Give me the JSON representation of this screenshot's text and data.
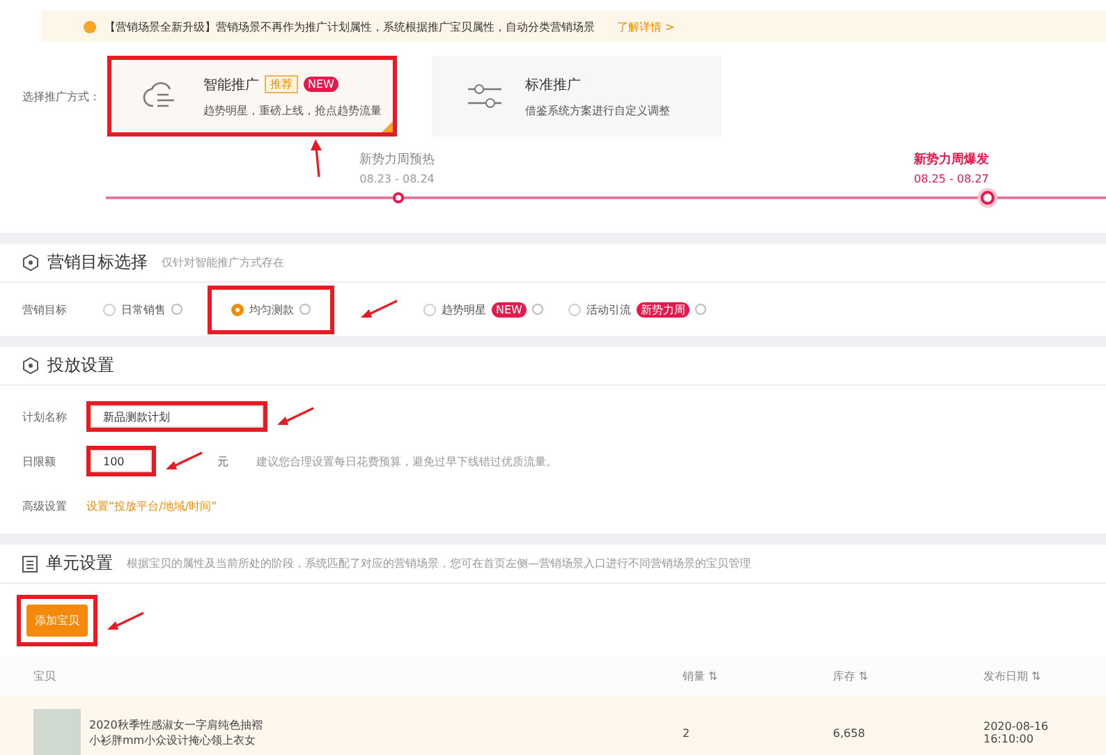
{
  "notice": {
    "text": "【营销场景全新升级】营销场景不再作为推广计划属性，系统根据推广宝贝属性，自动分类营销场景",
    "link": "了解详情 >"
  },
  "promotion": {
    "label": "选择推广方式：",
    "modes": [
      {
        "kind": "smart",
        "title": "智能推广",
        "tags": [
          {
            "text": "推荐",
            "kind": "outline"
          },
          {
            "text": "NEW",
            "kind": "solid"
          }
        ],
        "desc": "趋势明星，重磅上线，抢点趋势流量",
        "selected": true,
        "highlighted": true
      },
      {
        "kind": "standard",
        "title": "标准推广",
        "desc": "借鉴系统方案进行自定义调整",
        "selected": false,
        "highlighted": false
      }
    ]
  },
  "timeline": [
    {
      "title": "新势力周预热",
      "dates": "08.23 - 08.24",
      "selected": false
    },
    {
      "title": "新势力周爆发",
      "dates": "08.25 - 08.27",
      "selected": true
    }
  ],
  "goal_section": {
    "title": "营销目标选择",
    "hint": "仅针对智能推广方式存在",
    "label": "营销目标",
    "options": [
      {
        "label": "日常销售",
        "selected": false,
        "highlighted": false
      },
      {
        "label": "均匀测款",
        "selected": true,
        "highlighted": true
      },
      {
        "label": "趋势明星",
        "badge": "NEW",
        "selected": false,
        "highlighted": false
      },
      {
        "label": "活动引流",
        "badge": "新势力周",
        "selected": false,
        "highlighted": false
      }
    ]
  },
  "delivery_section": {
    "title": "投放设置",
    "fields": [
      {
        "kind": "text",
        "label": "计划名称",
        "value": "新品测款计划",
        "highlighted": true
      },
      {
        "kind": "money",
        "label": "日限额",
        "value": "100",
        "unit": "元",
        "hint": "建议您合理设置每日花费预算，避免过早下线错过优质流量。",
        "highlighted": true
      },
      {
        "kind": "link",
        "label": "高级设置",
        "value": "设置“投放平台/地域/时间”",
        "highlighted": false
      }
    ]
  },
  "unit_section": {
    "title": "单元设置",
    "hint": "根据宝贝的属性及当前所处的阶段，系统匹配了对应的营销场景，您可在首页左侧—营销场景入口进行不同营销场景的宝贝管理",
    "button": {
      "label": "添加宝贝",
      "highlighted": true
    },
    "table": {
      "columns": [
        "宝贝",
        "销量 ⇅",
        "库存 ⇅",
        "发布日期 ⇅"
      ],
      "rows": [
        {
          "title": "2020秋季性感淑女一字肩纯色抽褶小衫胖mm小众设计掩心领上衣女",
          "sales": "2",
          "stock": "6,658",
          "date": "2020-08-16 16:10:00"
        }
      ]
    }
  }
}
